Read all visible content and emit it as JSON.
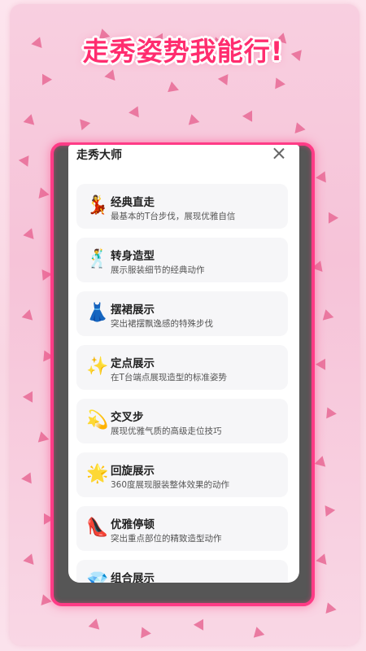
{
  "app": {
    "title": "走秀姿势我能行!"
  },
  "modal": {
    "title": "走秀大师",
    "close_icon": "close-icon"
  },
  "items": [
    {
      "emoji": "💃",
      "title": "经典直走",
      "desc": "最基本的T台步伐，展现优雅自信"
    },
    {
      "emoji": "🕺",
      "title": "转身造型",
      "desc": "展示服装细节的经典动作"
    },
    {
      "emoji": "👗",
      "title": "摆裙展示",
      "desc": "突出裙摆飘逸感的特殊步伐"
    },
    {
      "emoji": "✨",
      "title": "定点展示",
      "desc": "在T台端点展现造型的标准姿势"
    },
    {
      "emoji": "💫",
      "title": "交叉步",
      "desc": "展现优雅气质的高级走位技巧"
    },
    {
      "emoji": "🌟",
      "title": "回旋展示",
      "desc": "360度展现服装整体效果的动作"
    },
    {
      "emoji": "👠",
      "title": "优雅停顿",
      "desc": "突出重点部位的精致造型动作"
    },
    {
      "emoji": "💎",
      "title": "组合展示",
      "desc": ""
    }
  ],
  "colors": {
    "accent": "#ff2d6f",
    "frame": "#ff3b86",
    "background": "#f8cfe0"
  }
}
